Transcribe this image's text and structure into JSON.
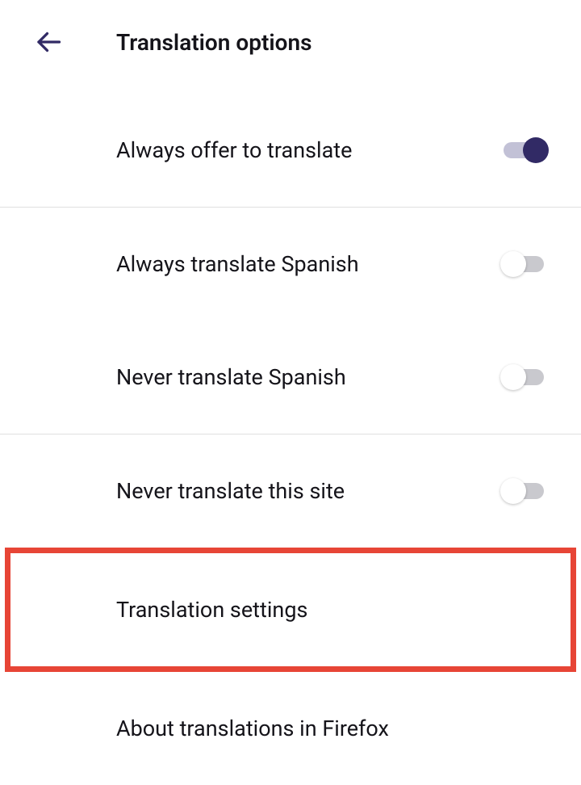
{
  "header": {
    "title": "Translation options"
  },
  "options": {
    "alwaysOffer": {
      "label": "Always offer to translate",
      "enabled": true
    },
    "alwaysTranslateLang": {
      "label": "Always translate Spanish",
      "enabled": false
    },
    "neverTranslateLang": {
      "label": "Never translate Spanish",
      "enabled": false
    },
    "neverTranslateSite": {
      "label": "Never translate this site",
      "enabled": false
    }
  },
  "links": {
    "settings": {
      "label": "Translation settings"
    },
    "about": {
      "label": "About translations in Firefox"
    }
  }
}
